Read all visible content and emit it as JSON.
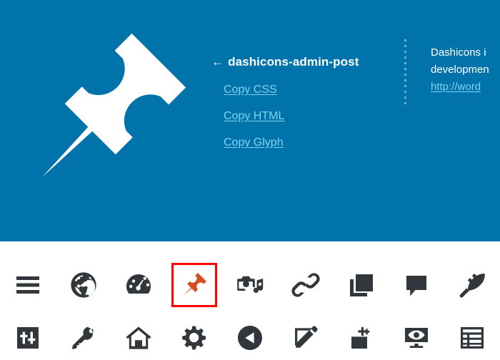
{
  "preview": {
    "background_color": "#0073aa",
    "glyph_color": "#ffffff",
    "glyph_icon": "pushpin-icon",
    "glyph_name": "dashicons-admin-post"
  },
  "detail": {
    "back_arrow": "←",
    "title": "dashicons-admin-post",
    "links": [
      {
        "name": "copy-css-link",
        "label": "Copy CSS"
      },
      {
        "name": "copy-html-link",
        "label": "Copy HTML"
      },
      {
        "name": "copy-glyph-link",
        "label": "Copy Glyph"
      }
    ]
  },
  "about": {
    "line1": "Dashicons i",
    "line2": "developmen",
    "url": "http://word"
  },
  "selection": {
    "selected_index": 3,
    "highlight_color": "#ff0000",
    "selected_icon_color": "#d54e21"
  },
  "grid": {
    "icon_color": "#32373c",
    "columns": 9,
    "icons": [
      {
        "name": "menu-icon",
        "label": "menu"
      },
      {
        "name": "site-globe-icon",
        "label": "admin-site"
      },
      {
        "name": "dashboard-gauge-icon",
        "label": "dashboard"
      },
      {
        "name": "pushpin-icon",
        "label": "admin-post"
      },
      {
        "name": "media-camera-icon",
        "label": "admin-media"
      },
      {
        "name": "link-chain-icon",
        "label": "admin-links"
      },
      {
        "name": "pages-stack-icon",
        "label": "admin-page"
      },
      {
        "name": "comment-bubble-icon",
        "label": "admin-comments"
      },
      {
        "name": "paintbrush-icon",
        "label": "admin-appearance"
      },
      {
        "name": "sliders-icon",
        "label": "admin-settings"
      },
      {
        "name": "key-icon",
        "label": "admin-network"
      },
      {
        "name": "home-icon",
        "label": "admin-home"
      },
      {
        "name": "gear-icon",
        "label": "admin-generic"
      },
      {
        "name": "back-circle-arrow-icon",
        "label": "admin-collapse"
      },
      {
        "name": "edit-pencil-icon",
        "label": "welcome-write-blog"
      },
      {
        "name": "add-page-icon",
        "label": "welcome-add-page"
      },
      {
        "name": "view-site-eye-icon",
        "label": "welcome-view-site"
      },
      {
        "name": "widgets-layout-icon",
        "label": "welcome-widgets-menus"
      }
    ]
  }
}
